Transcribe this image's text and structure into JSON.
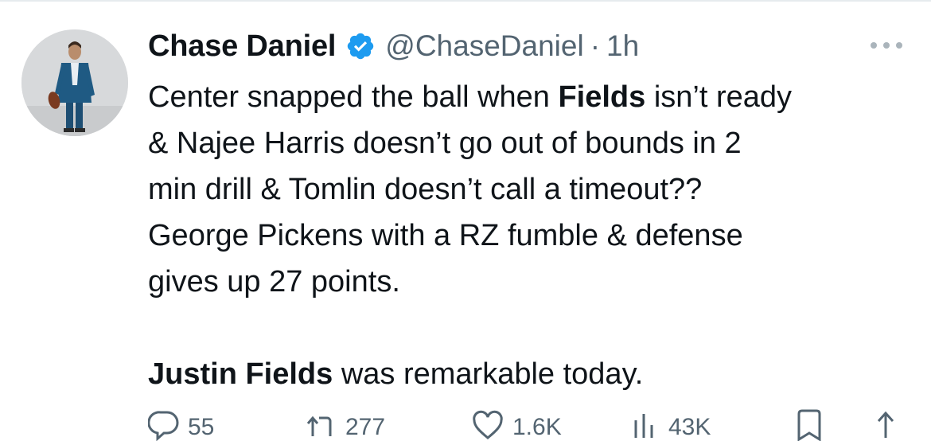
{
  "tweet": {
    "author_name": "Chase Daniel",
    "handle": "@ChaseDaniel",
    "separator": "·",
    "time": "1h",
    "lines": {
      "l1_pre": "Center snapped the ball when ",
      "l1_bold": "Fields",
      "l1_post": " isn’t ready",
      "l2": "& Najee Harris doesn’t go out of bounds in 2",
      "l3": "min drill & Tomlin doesn’t call a timeout??",
      "l4": "George Pickens with a RZ fumble & defense",
      "l5": "gives up 27 points.",
      "l6_bold": "Justin Fields",
      "l6_post": " was remarkable today."
    }
  },
  "actions": {
    "replies": "55",
    "retweets": "277",
    "likes": "1.6K",
    "views": "43K"
  },
  "icons": {
    "verified": "verified-badge-icon",
    "more": "more-options-icon",
    "reply": "reply-icon",
    "retweet": "retweet-icon",
    "like": "heart-icon",
    "views": "views-icon",
    "bookmark": "bookmark-icon",
    "share": "share-icon"
  },
  "colors": {
    "verified": "#1d9bf0",
    "text": "#0f1419",
    "secondary": "#536471"
  }
}
